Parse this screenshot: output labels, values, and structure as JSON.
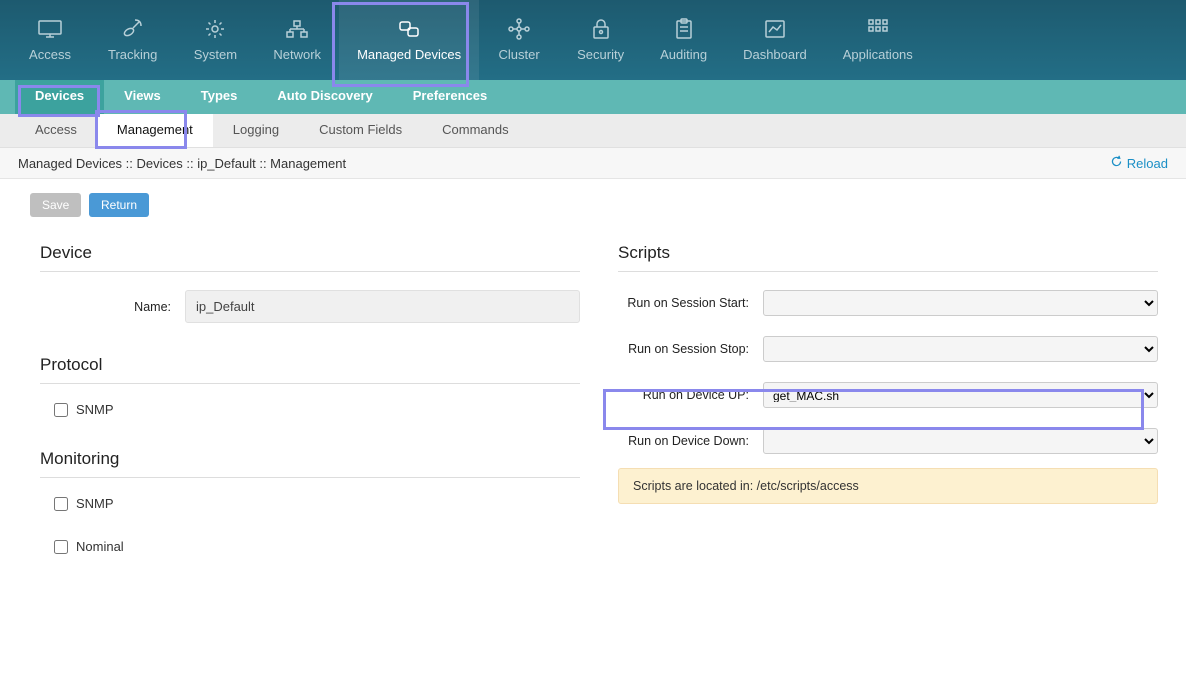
{
  "topnav": [
    {
      "label": "Access",
      "icon": "monitor"
    },
    {
      "label": "Tracking",
      "icon": "satellite"
    },
    {
      "label": "System",
      "icon": "gear"
    },
    {
      "label": "Network",
      "icon": "hierarchy"
    },
    {
      "label": "Managed Devices",
      "icon": "linked-boxes",
      "active": true
    },
    {
      "label": "Cluster",
      "icon": "nodes"
    },
    {
      "label": "Security",
      "icon": "lock"
    },
    {
      "label": "Auditing",
      "icon": "clipboard"
    },
    {
      "label": "Dashboard",
      "icon": "chart"
    },
    {
      "label": "Applications",
      "icon": "grid"
    }
  ],
  "subnav": [
    {
      "label": "Devices",
      "active": true
    },
    {
      "label": "Views"
    },
    {
      "label": "Types"
    },
    {
      "label": "Auto Discovery"
    },
    {
      "label": "Preferences"
    }
  ],
  "tertiary": [
    {
      "label": "Access"
    },
    {
      "label": "Management",
      "active": true
    },
    {
      "label": "Logging"
    },
    {
      "label": "Custom Fields"
    },
    {
      "label": "Commands"
    }
  ],
  "breadcrumb": "Managed Devices :: Devices :: ip_Default :: Management",
  "reload_label": "Reload",
  "buttons": {
    "save": "Save",
    "return": "Return"
  },
  "device_section": {
    "title": "Device",
    "name_label": "Name:",
    "name_value": "ip_Default"
  },
  "protocol_section": {
    "title": "Protocol",
    "snmp_label": "SNMP"
  },
  "monitoring_section": {
    "title": "Monitoring",
    "snmp_label": "SNMP",
    "nominal_label": "Nominal"
  },
  "scripts_section": {
    "title": "Scripts",
    "session_start_label": "Run on Session Start:",
    "session_start_value": "",
    "session_stop_label": "Run on Session Stop:",
    "session_stop_value": "",
    "device_up_label": "Run on Device UP:",
    "device_up_value": "get_MAC.sh",
    "device_down_label": "Run on Device Down:",
    "device_down_value": "",
    "info": "Scripts are located in: /etc/scripts/access"
  }
}
